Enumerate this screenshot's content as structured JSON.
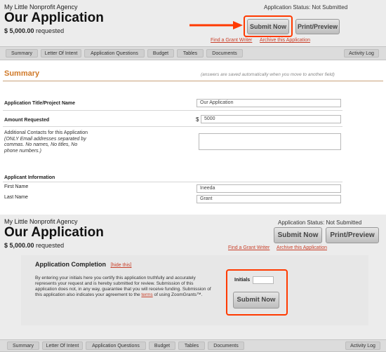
{
  "header": {
    "agency": "My Little Nonprofit Agency",
    "app_title": "Our Application",
    "amount_bold": "$ 5,000.00",
    "amount_suffix": " requested",
    "status_label": "Application Status: Not Submitted",
    "submit_label": "Submit Now",
    "print_label": "Print/Preview",
    "find_writer": "Find a Grant Writer",
    "archive": "Archive this Application"
  },
  "tabs": [
    "Summary",
    "Letter Of Intent",
    "Application Questions",
    "Budget",
    "Tables",
    "Documents"
  ],
  "activity_log": "Activity Log",
  "summary": {
    "title": "Summary",
    "note": "(answers are saved automatically when you move to another field)"
  },
  "form": {
    "title_label": "Application Title/Project Name",
    "title_value": "Our Application",
    "amount_label": "Amount Requested",
    "amount_prefix": "$",
    "amount_value": "5000",
    "contacts_label": "Additional Contacts for this Application",
    "contacts_hint": "(ONLY Email addresses separated by commas. No names, No titles, No phone numbers.)"
  },
  "applicant": {
    "heading": "Applicant Information",
    "first_label": "First Name",
    "first_value": "Ineeda",
    "last_label": "Last Name",
    "last_value": "Grant"
  },
  "completion": {
    "title": "Application Completion",
    "hide_link": "[hide this]",
    "body_1": "By entering your initials here you certify this application truthfully and accurately represents your request and is hereby submitted for review. Submission of this application does not, in any way, guarantee that you will receive funding. Submission of this application also indicates your agreement to the ",
    "terms_link": "terms",
    "body_2": " of using ZoomGrants™.",
    "initials_label": "Initials",
    "initials_value": "",
    "submit_label": "Submit Now"
  },
  "colors": {
    "highlight": "#ff3a00",
    "link": "#c8402a",
    "section_title": "#d07a2a"
  }
}
